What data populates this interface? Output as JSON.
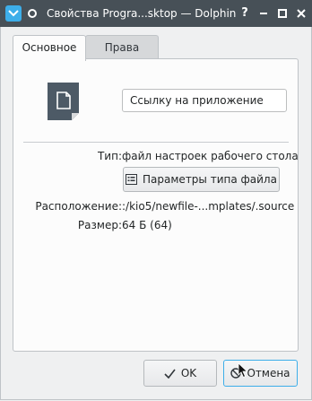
{
  "window": {
    "title": "Свойства Progra...sktop — Dolphin",
    "app_icon": "window-menu-icon",
    "pin_icon": "pin-icon",
    "controls": [
      "help-icon",
      "minimize-icon",
      "maximize-icon",
      "close-icon"
    ]
  },
  "tabs": [
    {
      "label": "Основное",
      "active": true
    },
    {
      "label": "Права",
      "active": false
    }
  ],
  "general": {
    "file_icon": "document-icon",
    "name_value": "Ссылку на приложение",
    "type_label": "Тип:",
    "type_value": "файл настроек рабочего стола",
    "file_type_button": "Параметры типа файла",
    "location_label": "Расположение:",
    "location_value": ":/kio5/newfile-...mplates/.source",
    "size_label": "Размер:",
    "size_value": "64 Б (64)"
  },
  "buttons": {
    "ok": "OK",
    "cancel": "Отмена"
  },
  "colors": {
    "titlebar": "#475057",
    "accent": "#3daee9",
    "window_bg": "#eff0f1"
  }
}
